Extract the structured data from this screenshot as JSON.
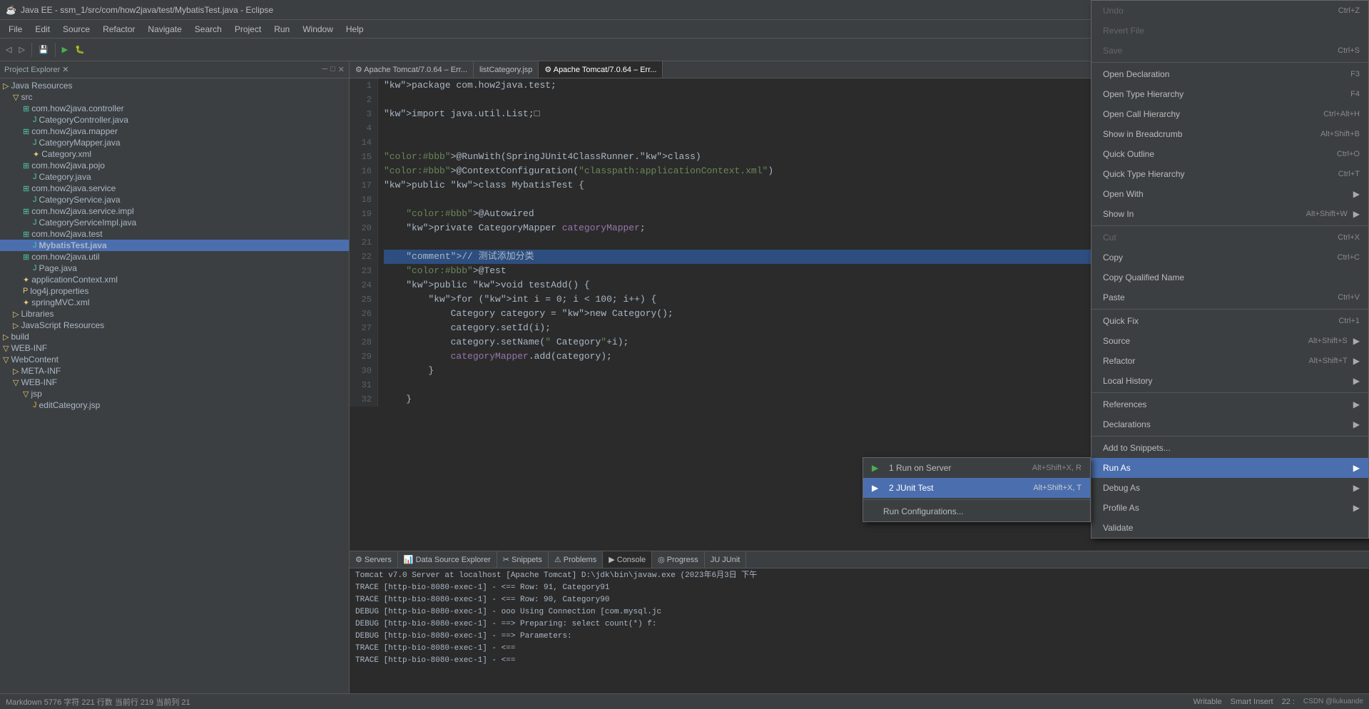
{
  "app": {
    "title": "Java EE - ssm_1/src/com/how2java/test/MybatisTest.java - Eclipse",
    "icon": "☕"
  },
  "menu": {
    "items": [
      "File",
      "Edit",
      "Source",
      "Refactor",
      "Navigate",
      "Search",
      "Project",
      "Run",
      "Window",
      "Help"
    ]
  },
  "editor_tabs": [
    {
      "label": "⚙ Apache Tomcat/7.0.64 – Err...",
      "active": false
    },
    {
      "label": "listCategory.jsp",
      "active": false
    },
    {
      "label": "⚙ Apache Tomcat/7.0.64 – Err...",
      "active": true
    }
  ],
  "explorer": {
    "title": "Project Explorer ✕",
    "tree": [
      {
        "indent": 0,
        "icon": "▷",
        "label": "Java Resources",
        "type": "folder"
      },
      {
        "indent": 1,
        "icon": "▽",
        "label": "src",
        "type": "folder"
      },
      {
        "indent": 2,
        "icon": "▽",
        "label": "com.how2java.controller",
        "type": "package"
      },
      {
        "indent": 3,
        "icon": "J",
        "label": "CategoryController.java",
        "type": "java"
      },
      {
        "indent": 2,
        "icon": "▽",
        "label": "com.how2java.mapper",
        "type": "package"
      },
      {
        "indent": 3,
        "icon": "M",
        "label": "CategoryMapper.java",
        "type": "java"
      },
      {
        "indent": 3,
        "icon": "X",
        "label": "Category.xml",
        "type": "xml"
      },
      {
        "indent": 2,
        "icon": "▽",
        "label": "com.how2java.pojo",
        "type": "package"
      },
      {
        "indent": 3,
        "icon": "J",
        "label": "Category.java",
        "type": "java"
      },
      {
        "indent": 2,
        "icon": "▽",
        "label": "com.how2java.service",
        "type": "package"
      },
      {
        "indent": 3,
        "icon": "J",
        "label": "CategoryService.java",
        "type": "java"
      },
      {
        "indent": 2,
        "icon": "▽",
        "label": "com.how2java.service.impl",
        "type": "package"
      },
      {
        "indent": 3,
        "icon": "J",
        "label": "CategoryServiceImpl.java",
        "type": "java"
      },
      {
        "indent": 2,
        "icon": "▽",
        "label": "com.how2java.test",
        "type": "package"
      },
      {
        "indent": 3,
        "icon": "J",
        "label": "MybatisTest.java",
        "type": "java",
        "selected": true
      },
      {
        "indent": 2,
        "icon": "▽",
        "label": "com.how2java.util",
        "type": "package"
      },
      {
        "indent": 3,
        "icon": "J",
        "label": "Page.java",
        "type": "java"
      },
      {
        "indent": 2,
        "icon": "X",
        "label": "applicationContext.xml",
        "type": "xml"
      },
      {
        "indent": 2,
        "icon": "P",
        "label": "log4j.properties",
        "type": "props"
      },
      {
        "indent": 2,
        "icon": "X",
        "label": "springMVC.xml",
        "type": "xml"
      },
      {
        "indent": 1,
        "icon": "▷",
        "label": "Libraries",
        "type": "folder"
      },
      {
        "indent": 1,
        "icon": "▷",
        "label": "JavaScript Resources",
        "type": "folder"
      },
      {
        "indent": 0,
        "icon": "▷",
        "label": "build",
        "type": "folder"
      },
      {
        "indent": 0,
        "icon": "▽",
        "label": "WEB-INF",
        "type": "folder"
      },
      {
        "indent": 0,
        "icon": "▽",
        "label": "WebContent",
        "type": "folder"
      },
      {
        "indent": 1,
        "icon": "▷",
        "label": "META-INF",
        "type": "folder"
      },
      {
        "indent": 1,
        "icon": "▽",
        "label": "WEB-INF",
        "type": "folder"
      },
      {
        "indent": 2,
        "icon": "▽",
        "label": "jsp",
        "type": "folder"
      },
      {
        "indent": 3,
        "icon": "J",
        "label": "editCategory.jsp",
        "type": "jsp"
      }
    ]
  },
  "code": {
    "lines": [
      {
        "num": 1,
        "text": "package com.how2java.test;",
        "highlight": false
      },
      {
        "num": 2,
        "text": "",
        "highlight": false
      },
      {
        "num": 3,
        "text": "import java.util.List;□",
        "highlight": false
      },
      {
        "num": 4,
        "text": "",
        "highlight": false
      },
      {
        "num": 14,
        "text": "",
        "highlight": false
      },
      {
        "num": 15,
        "text": "@RunWith(SpringJUnit4ClassRunner.class)",
        "highlight": false
      },
      {
        "num": 16,
        "text": "@ContextConfiguration(\"classpath:applicationContext.xml\")",
        "highlight": false
      },
      {
        "num": 17,
        "text": "public class MybatisTest {",
        "highlight": false
      },
      {
        "num": 18,
        "text": "",
        "highlight": false
      },
      {
        "num": 19,
        "text": "    @Autowired",
        "highlight": false
      },
      {
        "num": 20,
        "text": "    private CategoryMapper categoryMapper;",
        "highlight": false
      },
      {
        "num": 21,
        "text": "",
        "highlight": false
      },
      {
        "num": 22,
        "text": "    // 测试添加分类",
        "highlight": true
      },
      {
        "num": 23,
        "text": "    @Test",
        "highlight": false
      },
      {
        "num": 24,
        "text": "    public void testAdd() {",
        "highlight": false
      },
      {
        "num": 25,
        "text": "        for (int i = 0; i < 100; i++) {",
        "highlight": false
      },
      {
        "num": 26,
        "text": "            Category category = new Category();",
        "highlight": false
      },
      {
        "num": 27,
        "text": "            category.setId(i);",
        "highlight": false
      },
      {
        "num": 28,
        "text": "            category.setName(\" Category\"+i);",
        "highlight": false
      },
      {
        "num": 29,
        "text": "            categoryMapper.add(category);",
        "highlight": false
      },
      {
        "num": 30,
        "text": "        }",
        "highlight": false
      },
      {
        "num": 31,
        "text": "",
        "highlight": false
      },
      {
        "num": 32,
        "text": "    }",
        "highlight": false
      }
    ]
  },
  "bottom_tabs": [
    {
      "label": "⚙ Servers",
      "active": false
    },
    {
      "label": "📊 Data Source Explorer",
      "active": false
    },
    {
      "label": "✂ Snippets",
      "active": false
    },
    {
      "label": "⚠ Problems",
      "active": false
    },
    {
      "label": "▶ Console",
      "active": true
    },
    {
      "label": "◎ Progress",
      "active": false
    },
    {
      "label": "JU JUnit",
      "active": false
    }
  ],
  "console_lines": [
    "Tomcat v7.0 Server at localhost [Apache Tomcat] D:\\jdk\\bin\\javaw.exe (2023年6月3日 下午",
    "TRACE [http-bio-8080-exec-1] -  <==          Row: 91,  Category91",
    "TRACE [http-bio-8080-exec-1] -  <==          Row: 90,  Category90",
    "DEBUG [http-bio-8080-exec-1] -  ooo Using Connection [com.mysql.jc",
    "DEBUG [http-bio-8080-exec-1] -  ==>  Preparing: select count(*) f:",
    "DEBUG [http-bio-8080-exec-1] -  ==> Parameters:",
    "TRACE [http-bio-8080-exec-1] -  <==",
    "TRACE [http-bio-8080-exec-1] -  <=="
  ],
  "context_menu": {
    "items": [
      {
        "id": "undo",
        "label": "Undo",
        "shortcut": "Ctrl+Z",
        "disabled": true,
        "has_arrow": false
      },
      {
        "id": "revert",
        "label": "Revert File",
        "shortcut": "",
        "disabled": true,
        "has_arrow": false
      },
      {
        "id": "save",
        "label": "Save",
        "shortcut": "Ctrl+S",
        "disabled": true,
        "has_arrow": false
      },
      {
        "id": "sep1",
        "type": "separator"
      },
      {
        "id": "open-declaration",
        "label": "Open Declaration",
        "shortcut": "F3",
        "has_arrow": false
      },
      {
        "id": "open-type-hierarchy",
        "label": "Open Type Hierarchy",
        "shortcut": "F4",
        "has_arrow": false
      },
      {
        "id": "open-call-hierarchy",
        "label": "Open Call Hierarchy",
        "shortcut": "Ctrl+Alt+H",
        "has_arrow": false
      },
      {
        "id": "show-breadcrumb",
        "label": "Show in Breadcrumb",
        "shortcut": "Alt+Shift+B",
        "has_arrow": false
      },
      {
        "id": "quick-outline",
        "label": "Quick Outline",
        "shortcut": "Ctrl+O",
        "has_arrow": false
      },
      {
        "id": "quick-type-hierarchy",
        "label": "Quick Type Hierarchy",
        "shortcut": "Ctrl+T",
        "has_arrow": false
      },
      {
        "id": "open-with",
        "label": "Open With",
        "shortcut": "",
        "has_arrow": true
      },
      {
        "id": "show-in",
        "label": "Show In",
        "shortcut": "Alt+Shift+W",
        "has_arrow": true
      },
      {
        "id": "sep2",
        "type": "separator"
      },
      {
        "id": "cut",
        "label": "Cut",
        "shortcut": "Ctrl+X",
        "disabled": true,
        "has_arrow": false
      },
      {
        "id": "copy",
        "label": "Copy",
        "shortcut": "Ctrl+C",
        "has_arrow": false
      },
      {
        "id": "copy-qualified",
        "label": "Copy Qualified Name",
        "shortcut": "",
        "has_arrow": false
      },
      {
        "id": "paste",
        "label": "Paste",
        "shortcut": "Ctrl+V",
        "has_arrow": false
      },
      {
        "id": "sep3",
        "type": "separator"
      },
      {
        "id": "quick-fix",
        "label": "Quick Fix",
        "shortcut": "Ctrl+1",
        "has_arrow": false
      },
      {
        "id": "source",
        "label": "Source",
        "shortcut": "Alt+Shift+S",
        "has_arrow": true
      },
      {
        "id": "refactor",
        "label": "Refactor",
        "shortcut": "Alt+Shift+T",
        "has_arrow": true
      },
      {
        "id": "local-history",
        "label": "Local History",
        "shortcut": "",
        "has_arrow": true
      },
      {
        "id": "sep4",
        "type": "separator"
      },
      {
        "id": "references",
        "label": "References",
        "shortcut": "",
        "has_arrow": true
      },
      {
        "id": "declarations",
        "label": "Declarations",
        "shortcut": "",
        "has_arrow": true
      },
      {
        "id": "sep5",
        "type": "separator"
      },
      {
        "id": "add-snippets",
        "label": "Add to Snippets...",
        "shortcut": "",
        "has_arrow": false
      },
      {
        "id": "run-as",
        "label": "Run As",
        "shortcut": "",
        "has_arrow": true,
        "highlighted": true
      },
      {
        "id": "debug-as",
        "label": "Debug As",
        "shortcut": "",
        "has_arrow": true
      },
      {
        "id": "profile-as",
        "label": "Profile As",
        "shortcut": "",
        "has_arrow": true
      },
      {
        "id": "validate",
        "label": "Validate",
        "shortcut": "",
        "has_arrow": false
      }
    ]
  },
  "run_submenu": {
    "items": [
      {
        "label": "1 Run on Server",
        "shortcut": "Alt+Shift+X, R",
        "icon": "▶"
      },
      {
        "label": "2 JUnit Test",
        "shortcut": "Alt+Shift+X, T",
        "icon": "▶",
        "selected": true
      }
    ],
    "separator_after": 1,
    "extra": "Run Configurations..."
  },
  "status_bar": {
    "left": "Markdown  5776 字符  221 行数  当前行 219  当前列 21",
    "right": [
      "Writable",
      "Smart Insert",
      "22 :"
    ]
  }
}
